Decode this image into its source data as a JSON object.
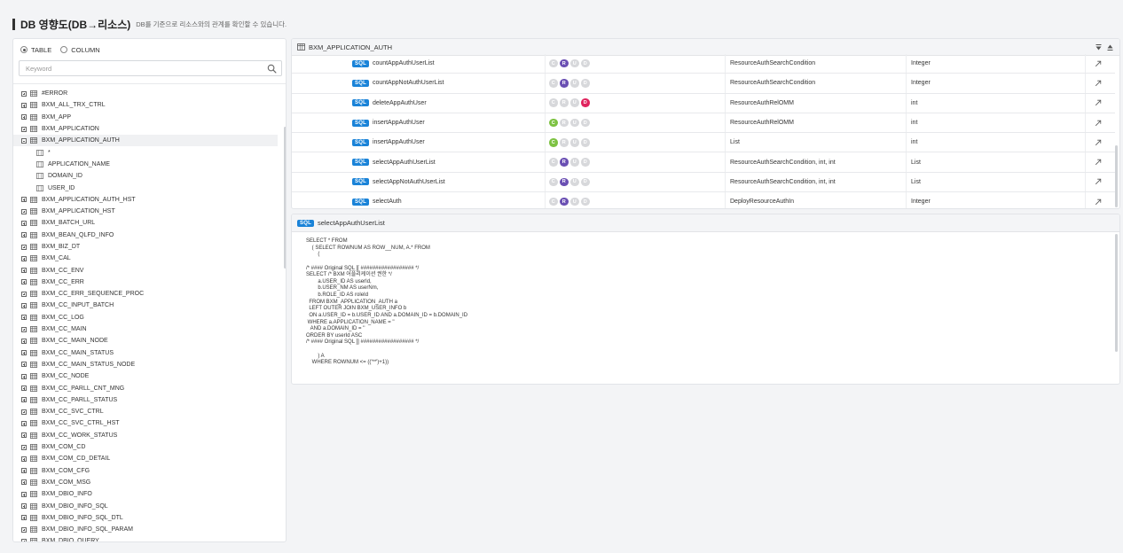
{
  "header": {
    "title": "DB 영향도(DB→리소스)",
    "description": "DB를 기준으로 리소스와의 관계를 확인할 수 있습니다."
  },
  "left": {
    "radio_table": "TABLE",
    "radio_column": "COLUMN",
    "selected_radio": "TABLE",
    "search_placeholder": "Keyword",
    "search_value": "",
    "tree": [
      {
        "label": "#ERROR",
        "type": "table",
        "expanded": false
      },
      {
        "label": "BXM_ALL_TRX_CTRL",
        "type": "table",
        "expanded": false
      },
      {
        "label": "BXM_APP",
        "type": "table",
        "expanded": false
      },
      {
        "label": "BXM_APPLICATION",
        "type": "table",
        "expanded": false
      },
      {
        "label": "BXM_APPLICATION_AUTH",
        "type": "table",
        "expanded": true,
        "selected": true
      },
      {
        "label": "*",
        "type": "column"
      },
      {
        "label": "APPLICATION_NAME",
        "type": "column"
      },
      {
        "label": "DOMAIN_ID",
        "type": "column"
      },
      {
        "label": "USER_ID",
        "type": "column"
      },
      {
        "label": "BXM_APPLICATION_AUTH_HST",
        "type": "table",
        "expanded": false
      },
      {
        "label": "BXM_APPLICATION_HST",
        "type": "table",
        "expanded": false
      },
      {
        "label": "BXM_BATCH_URL",
        "type": "table",
        "expanded": false
      },
      {
        "label": "BXM_BEAN_QLFD_INFO",
        "type": "table",
        "expanded": false
      },
      {
        "label": "BXM_BIZ_DT",
        "type": "table",
        "expanded": false
      },
      {
        "label": "BXM_CAL",
        "type": "table",
        "expanded": false
      },
      {
        "label": "BXM_CC_ENV",
        "type": "table",
        "expanded": false
      },
      {
        "label": "BXM_CC_ERR",
        "type": "table",
        "expanded": false
      },
      {
        "label": "BXM_CC_ERR_SEQUENCE_PROC",
        "type": "table",
        "expanded": false
      },
      {
        "label": "BXM_CC_INPUT_BATCH",
        "type": "table",
        "expanded": false
      },
      {
        "label": "BXM_CC_LOG",
        "type": "table",
        "expanded": false
      },
      {
        "label": "BXM_CC_MAIN",
        "type": "table",
        "expanded": false
      },
      {
        "label": "BXM_CC_MAIN_NODE",
        "type": "table",
        "expanded": false
      },
      {
        "label": "BXM_CC_MAIN_STATUS",
        "type": "table",
        "expanded": false
      },
      {
        "label": "BXM_CC_MAIN_STATUS_NODE",
        "type": "table",
        "expanded": false
      },
      {
        "label": "BXM_CC_NODE",
        "type": "table",
        "expanded": false
      },
      {
        "label": "BXM_CC_PARLL_CNT_MNG",
        "type": "table",
        "expanded": false
      },
      {
        "label": "BXM_CC_PARLL_STATUS",
        "type": "table",
        "expanded": false
      },
      {
        "label": "BXM_CC_SVC_CTRL",
        "type": "table",
        "expanded": false
      },
      {
        "label": "BXM_CC_SVC_CTRL_HST",
        "type": "table",
        "expanded": false
      },
      {
        "label": "BXM_CC_WORK_STATUS",
        "type": "table",
        "expanded": false
      },
      {
        "label": "BXM_COM_CD",
        "type": "table",
        "expanded": false
      },
      {
        "label": "BXM_COM_CD_DETAIL",
        "type": "table",
        "expanded": false
      },
      {
        "label": "BXM_COM_CFG",
        "type": "table",
        "expanded": false
      },
      {
        "label": "BXM_COM_MSG",
        "type": "table",
        "expanded": false
      },
      {
        "label": "BXM_DBIO_INFO",
        "type": "table",
        "expanded": false
      },
      {
        "label": "BXM_DBIO_INFO_SQL",
        "type": "table",
        "expanded": false
      },
      {
        "label": "BXM_DBIO_INFO_SQL_DTL",
        "type": "table",
        "expanded": false
      },
      {
        "label": "BXM_DBIO_INFO_SQL_PARAM",
        "type": "table",
        "expanded": false
      },
      {
        "label": "BXM_DBIO_QUERY",
        "type": "table",
        "expanded": false
      }
    ]
  },
  "sql_list": {
    "title": "BXM_APPLICATION_AUTH",
    "badge": "SQL",
    "rows": [
      {
        "name": "countAppAuthUserList",
        "crud": [
          "",
          "R",
          "",
          ""
        ],
        "param": "ResourceAuthSearchCondition",
        "ret": "Integer"
      },
      {
        "name": "countAppNotAuthUserList",
        "crud": [
          "",
          "R",
          "",
          ""
        ],
        "param": "ResourceAuthSearchCondition",
        "ret": "Integer"
      },
      {
        "name": "deleteAppAuthUser",
        "crud": [
          "",
          "",
          "",
          "D"
        ],
        "param": "ResourceAuthRelOMM",
        "ret": "int"
      },
      {
        "name": "insertAppAuthUser",
        "crud": [
          "C",
          "",
          "",
          ""
        ],
        "param": "ResourceAuthRelOMM",
        "ret": "int"
      },
      {
        "name": "insertAppAuthUser",
        "crud": [
          "C",
          "",
          "",
          ""
        ],
        "param": "List",
        "ret": "int"
      },
      {
        "name": "selectAppAuthUserList",
        "crud": [
          "",
          "R",
          "",
          ""
        ],
        "param": "ResourceAuthSearchCondition, int, int",
        "ret": "List"
      },
      {
        "name": "selectAppNotAuthUserList",
        "crud": [
          "",
          "R",
          "",
          ""
        ],
        "param": "ResourceAuthSearchCondition, int, int",
        "ret": "List"
      },
      {
        "name": "selectAuth",
        "crud": [
          "",
          "R",
          "",
          ""
        ],
        "param": "DeployResourceAuthIn",
        "ret": "Integer"
      }
    ]
  },
  "sql_detail": {
    "badge": "SQL",
    "title": "selectAppAuthUserList",
    "code": "SELECT * FROM\n    ( SELECT ROWNUM AS ROW__NUM, A.* FROM\n        (\n\n/* #### Original SQL [[ ################## */\nSELECT /* BXM 어플리케이션 권한 */\n        a.USER_ID AS userId,\n        b.USER_NM AS userNm,\n        b.ROLE_ID AS roleId\n  FROM BXM_APPLICATION_AUTH a\n  LEFT OUTER JOIN BXM_USER_INFO b\n  ON a.USER_ID = b.USER_ID AND a.DOMAIN_ID = b.DOMAIN_ID\n WHERE a.APPLICATION_NAME = ''\n   AND a.DOMAIN_ID = ''\nORDER BY userId ASC\n/* #### Original SQL ]] ################## */\n\n        ) A\n    WHERE ROWNUM <= (('**')+1))"
  },
  "colors": {
    "C": "#7dc242",
    "R": "#6a4fb3",
    "U": "#d7d8db",
    "D": "#e0245e",
    "inactive": "#d7d8db",
    "sql_badge": "#1a83d8"
  }
}
